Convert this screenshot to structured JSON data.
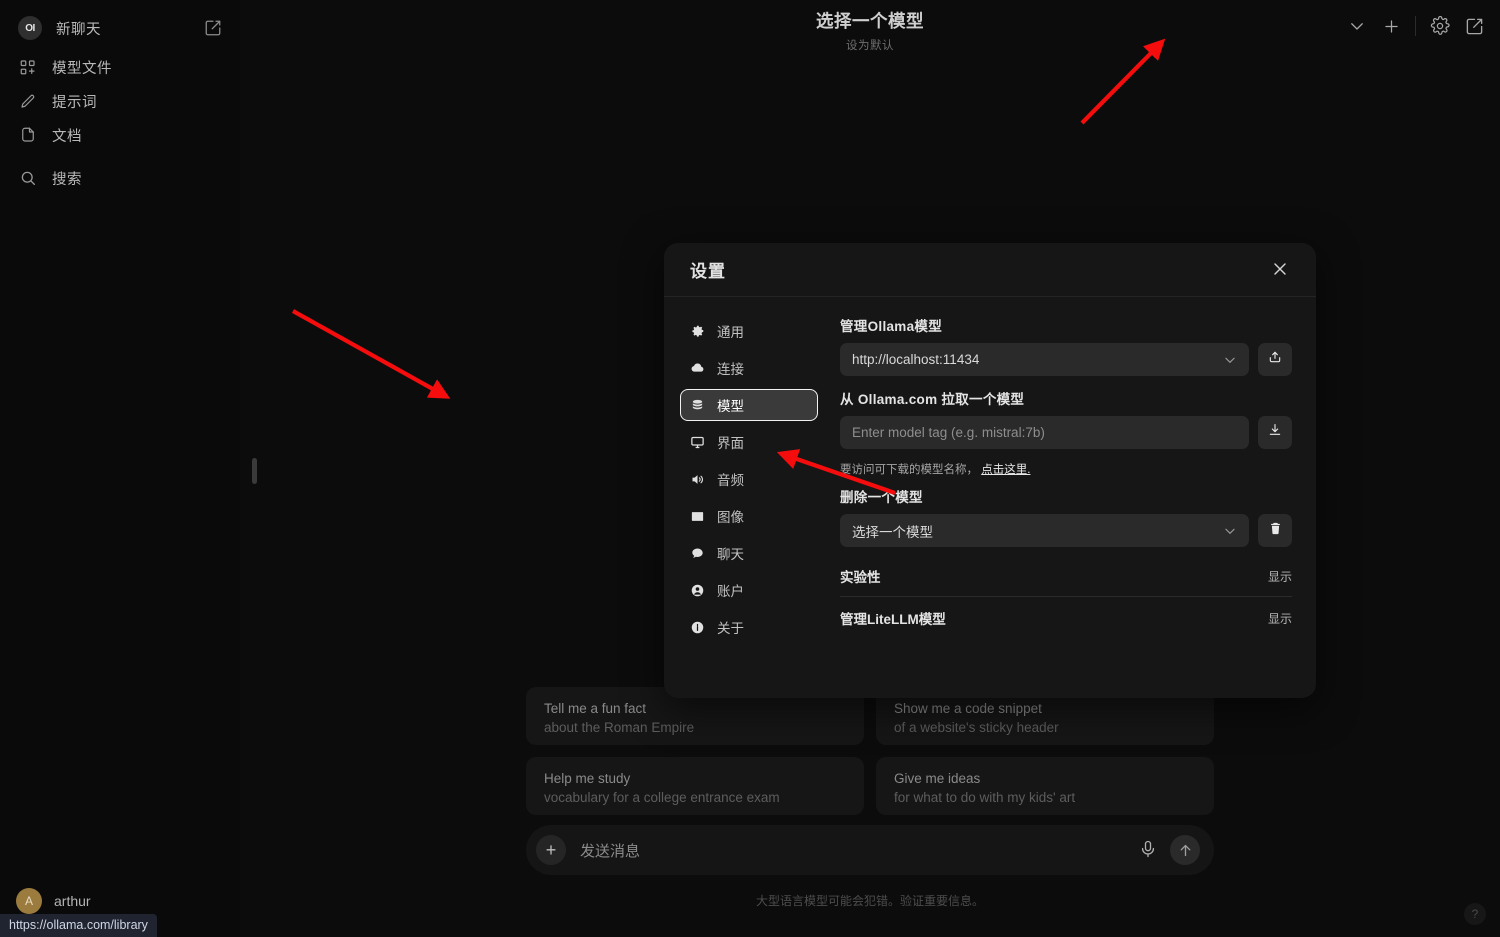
{
  "sidebar": {
    "items": [
      {
        "label": "新聊天",
        "icon": "openwebui-logo-icon",
        "name": "new-chat"
      },
      {
        "label": "模型文件",
        "icon": "modelfiles-icon",
        "name": "modelfiles"
      },
      {
        "label": "提示词",
        "icon": "pencil-icon",
        "name": "prompts"
      },
      {
        "label": "文档",
        "icon": "document-icon",
        "name": "documents"
      },
      {
        "label": "搜索",
        "icon": "search-icon",
        "name": "search"
      }
    ],
    "logo_text": "OI",
    "edit_icon": "new-chat-pencil-icon",
    "user": {
      "name": "arthur",
      "initial": "A"
    }
  },
  "status_bar": {
    "url": "https://ollama.com/library"
  },
  "header": {
    "title": "选择一个模型",
    "subtitle": "设为默认",
    "actions": [
      {
        "name": "chevron-down-icon",
        "label": "chevron-down-icon"
      },
      {
        "name": "plus-icon",
        "label": "plus-icon"
      },
      {
        "name": "gear-icon",
        "label": "gear-icon"
      },
      {
        "name": "compose-icon",
        "label": "compose-icon"
      }
    ]
  },
  "suggestions": [
    {
      "title": "Tell me a fun fact",
      "subtitle": "about the Roman Empire"
    },
    {
      "title": "Show me a code snippet",
      "subtitle": "of a website's sticky header"
    },
    {
      "title": "Help me study",
      "subtitle": "vocabulary for a college entrance exam"
    },
    {
      "title": "Give me ideas",
      "subtitle": "for what to do with my kids' art"
    }
  ],
  "composer": {
    "placeholder": "发送消息",
    "plus_label": "+",
    "mic_icon": "microphone-icon",
    "send_icon": "send-arrow-up-icon"
  },
  "disclaimer": "大型语言模型可能会犯错。验证重要信息。",
  "help_button": {
    "label": "?"
  },
  "settings": {
    "title": "设置",
    "close_label": "×",
    "nav": [
      {
        "label": "通用",
        "icon": "gear-icon",
        "active": false
      },
      {
        "label": "连接",
        "icon": "cloud-icon",
        "active": false
      },
      {
        "label": "模型",
        "icon": "stack-icon",
        "active": true
      },
      {
        "label": "界面",
        "icon": "monitor-icon",
        "active": false
      },
      {
        "label": "音频",
        "icon": "speaker-icon",
        "active": false
      },
      {
        "label": "图像",
        "icon": "image-icon",
        "active": false
      },
      {
        "label": "聊天",
        "icon": "chat-bubble-icon",
        "active": false
      },
      {
        "label": "账户",
        "icon": "user-circle-icon",
        "active": false
      },
      {
        "label": "关于",
        "icon": "info-circle-icon",
        "active": false
      }
    ],
    "manage_ollama": {
      "label": "管理Ollama模型",
      "value": "http://localhost:11434",
      "action_icon": "update-all-icon"
    },
    "pull_model": {
      "label": "从 Ollama.com 拉取一个模型",
      "placeholder": "Enter model tag (e.g. mistral:7b)",
      "action_icon": "download-icon"
    },
    "hint": {
      "text": "要访问可下载的模型名称，",
      "link": "点击这里."
    },
    "delete_model": {
      "label": "删除一个模型",
      "value": "选择一个模型",
      "action_icon": "trash-icon"
    },
    "rows": [
      {
        "label": "实验性",
        "action": "显示"
      },
      {
        "label": "管理LiteLLM模型",
        "action": "显示"
      }
    ]
  },
  "colors": {
    "accent_red": "#f50d0d",
    "active_nav_bg": "#3a3a3a",
    "avatar_bg": "#9c7b3e"
  }
}
